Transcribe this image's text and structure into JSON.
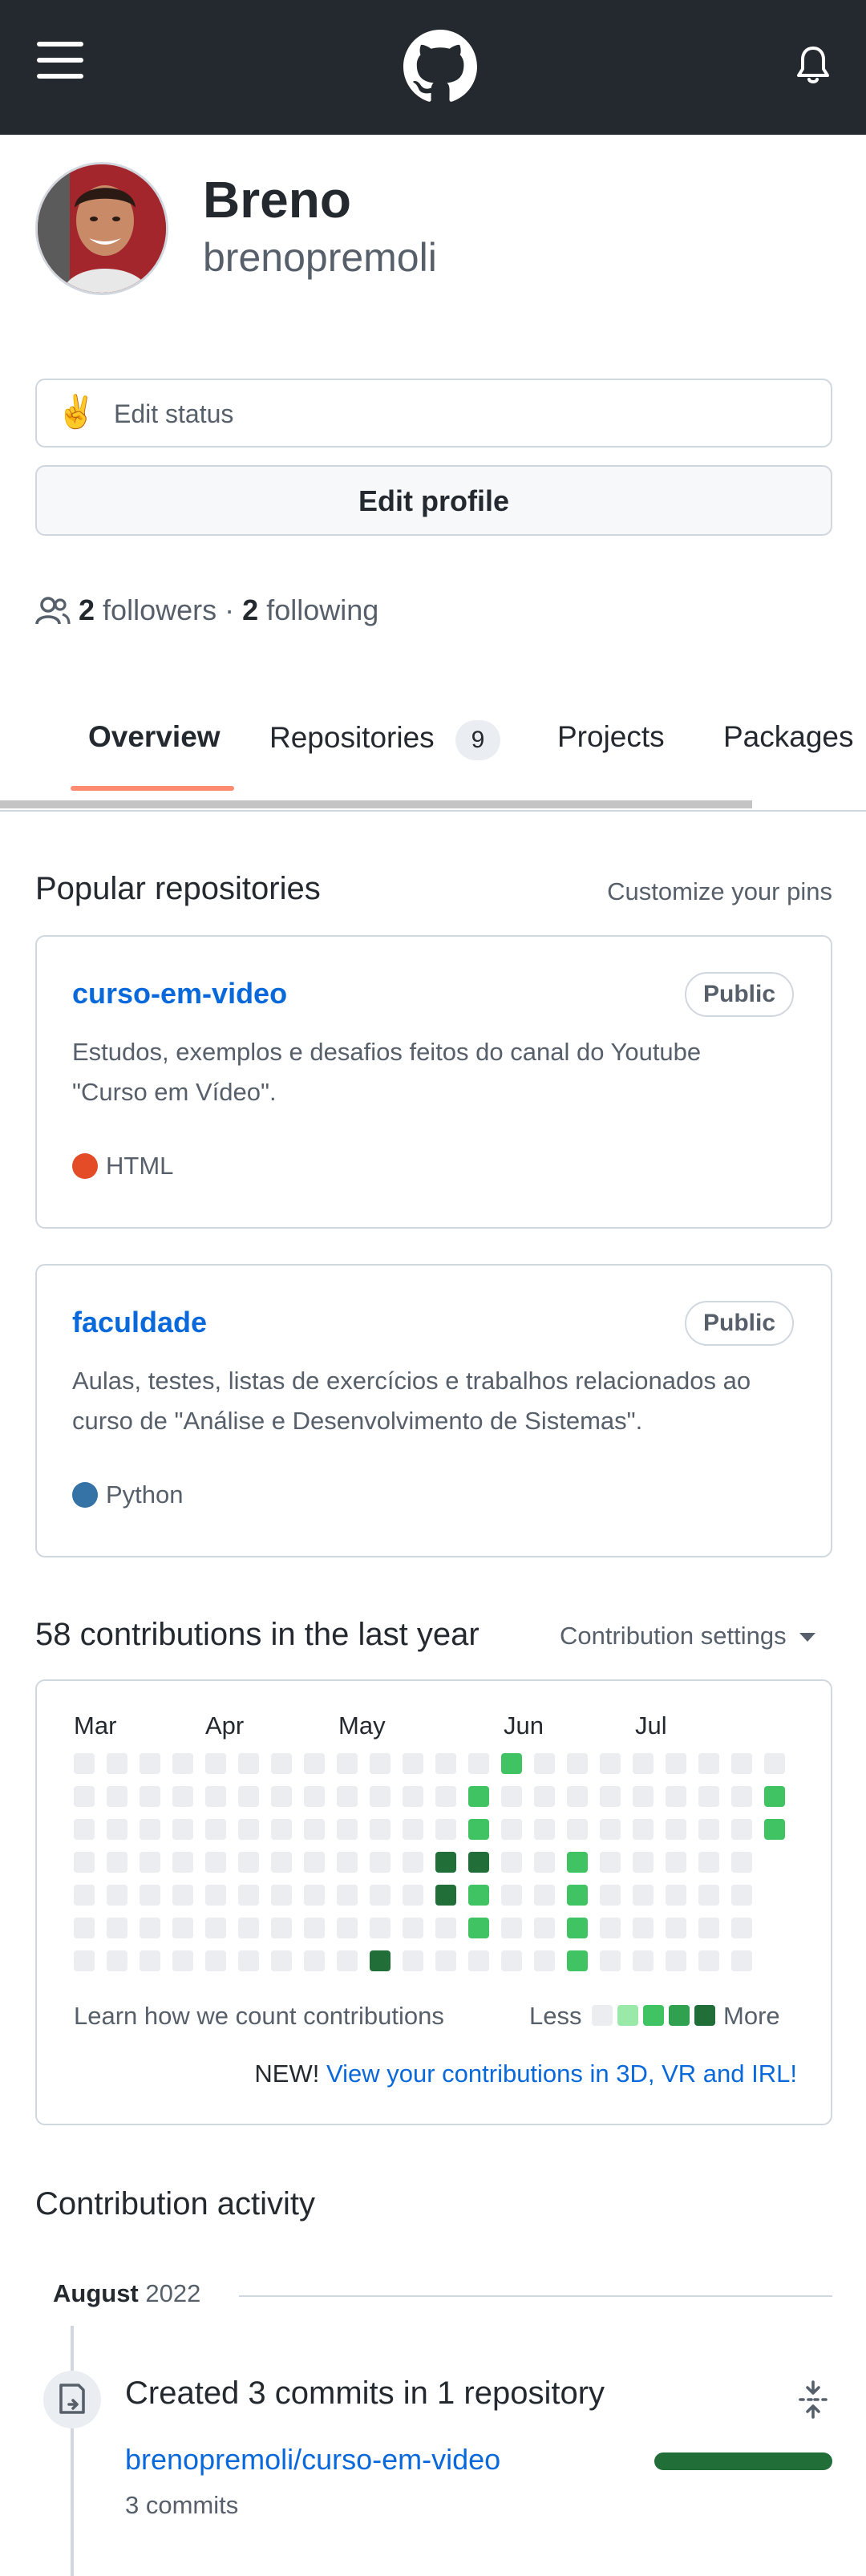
{
  "header": {
    "menu_icon": "hamburger-menu-icon",
    "logo_icon": "github-octocat-icon",
    "bell_icon": "bell-icon",
    "background": "#24292f"
  },
  "profile": {
    "name": "Breno",
    "username": "brenopremoli",
    "status_emoji": "✌️",
    "edit_status_label": "Edit status",
    "edit_profile_label": "Edit profile",
    "followers_count": "2",
    "followers_label": "followers",
    "separator": "·",
    "following_count": "2",
    "following_label": "following"
  },
  "tabs": [
    {
      "label": "Overview",
      "active": true
    },
    {
      "label": "Repositories",
      "count": "9"
    },
    {
      "label": "Projects"
    },
    {
      "label": "Packages"
    }
  ],
  "popular": {
    "title": "Popular repositories",
    "customize_label": "Customize your pins",
    "repos": [
      {
        "name": "curso-em-video",
        "visibility": "Public",
        "description_line1": "Estudos, exemplos e desafios feitos do canal do Youtube",
        "description_line2": "\"Curso em Vídeo\".",
        "language": "HTML",
        "language_color": "#e34c26"
      },
      {
        "name": "faculdade",
        "visibility": "Public",
        "description_line1": "Aulas, testes, listas de exercícios e trabalhos relacionados ao",
        "description_line2": "curso de \"Análise e Desenvolvimento de Sistemas\".",
        "language": "Python",
        "language_color": "#3572A5"
      }
    ]
  },
  "contributions": {
    "title": "58 contributions in the last year",
    "settings_label": "Contribution settings",
    "months": [
      "Mar",
      "Apr",
      "May",
      "Jun",
      "Jul"
    ],
    "learn_label": "Learn how we count contributions",
    "less_label": "Less",
    "more_label": "More",
    "new_prefix": "NEW!",
    "new_link": "View your contributions in 3D, VR and IRL!",
    "level_colors": [
      "#ebedf0",
      "#9be9a8",
      "#40c463",
      "#30a14e",
      "#216e39"
    ]
  },
  "activity": {
    "title": "Contribution activity",
    "month_label": "August",
    "year_label": "2022",
    "item_title": "Created 3 commits in 1 repository",
    "repo_link": "brenopremoli/curso-em-video",
    "commit_count": "3 commits",
    "bar_color": "#216e39"
  }
}
